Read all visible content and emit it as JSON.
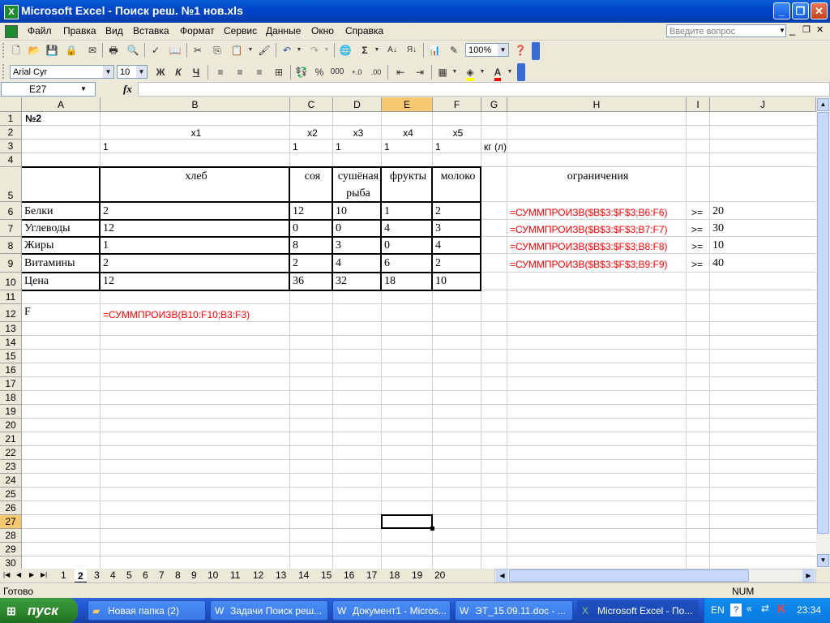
{
  "window": {
    "title": "Microsoft Excel - Поиск реш. №1 нов.xls",
    "app_icon_glyph": "X",
    "minimize_glyph": "_",
    "restore_glyph": "❐",
    "close_glyph": "✕"
  },
  "menu": {
    "items": [
      "Файл",
      "Правка",
      "Вид",
      "Вставка",
      "Формат",
      "Сервис",
      "Данные",
      "Окно",
      "Справка"
    ],
    "help_placeholder": "Введите вопрос",
    "doc_min_glyph": "_",
    "doc_restore_glyph": "❐",
    "doc_close_glyph": "✕"
  },
  "toolbar": {
    "zoom": "100%",
    "font_name": "Arial Cyr",
    "font_size": "10",
    "bold": "Ж",
    "italic": "К",
    "underline": "Ч",
    "percent": "%",
    "thousands": "000",
    "sigma": "Σ",
    "font_color_letter": "A"
  },
  "formula_bar": {
    "name_box": "E27",
    "fx": "fx",
    "content": ""
  },
  "sheet": {
    "columns": [
      "A",
      "B",
      "C",
      "D",
      "E",
      "F",
      "G",
      "H",
      "I",
      "J"
    ],
    "selected_column": "E",
    "selected_row": "27",
    "rows": [
      "1",
      "2",
      "3",
      "4",
      "5",
      "6",
      "7",
      "8",
      "9",
      "10",
      "11",
      "12",
      "13",
      "14",
      "15",
      "16",
      "17",
      "18",
      "19",
      "20",
      "21",
      "22",
      "23",
      "24",
      "25",
      "26",
      "27",
      "28",
      "29",
      "30"
    ],
    "cells": {
      "A1": "№2",
      "B2": "x1",
      "C2": "x2",
      "D2": "x3",
      "E2": "x4",
      "F2": "x5",
      "B3": "1",
      "C3": "1",
      "D3": "1",
      "E3": "1",
      "F3": "1",
      "G3": "кг (л)",
      "B5": "хлеб",
      "C5": "соя",
      "D5a": "сушёная",
      "D5b": "рыба",
      "E5": "фрукты",
      "F5": "молоко",
      "H5": "ограничения",
      "A6": "Белки",
      "B6": "2",
      "C6": "12",
      "D6": "10",
      "E6": "1",
      "F6": "2",
      "H6": "=СУММПРОИЗВ($B$3:$F$3;B6:F6)",
      "I6": ">=",
      "J6": "20",
      "A7": "Углеводы",
      "B7": "12",
      "C7": "0",
      "D7": "0",
      "E7": "4",
      "F7": "3",
      "H7": "=СУММПРОИЗВ($B$3:$F$3;B7:F7)",
      "I7": ">=",
      "J7": "30",
      "A8": "Жиры",
      "B8": "1",
      "C8": "8",
      "D8": "3",
      "E8": "0",
      "F8": "4",
      "H8": "=СУММПРОИЗВ($B$3:$F$3;B8:F8)",
      "I8": ">=",
      "J8": "10",
      "A9": "Витамины",
      "B9": "2",
      "C9": "2",
      "D9": "4",
      "E9": "6",
      "F9": "2",
      "H9": "=СУММПРОИЗВ($B$3:$F$3;B9:F9)",
      "I9": ">=",
      "J9": "40",
      "A10": "Цена",
      "B10": "12",
      "C10": "36",
      "D10": "32",
      "E10": "18",
      "F10": "10",
      "A12": "F",
      "B12": "=СУММПРОИЗВ(B10:F10;B3:F3)"
    }
  },
  "tabs": {
    "items": [
      "1",
      "2",
      "3",
      "4",
      "5",
      "6",
      "7",
      "8",
      "9",
      "10",
      "11",
      "12",
      "13",
      "14",
      "15",
      "16",
      "17",
      "18",
      "19",
      "20"
    ],
    "active": "2"
  },
  "status": {
    "left": "Готово",
    "num": "NUM"
  },
  "taskbar": {
    "start": "пуск",
    "items": [
      "Новая папка (2)",
      "Задачи Поиск реш...",
      "Документ1 - Micros...",
      "ЭТ_15.09.11.doc - ...",
      "Microsoft Excel - По..."
    ],
    "lang": "EN",
    "clock": "23:34"
  }
}
